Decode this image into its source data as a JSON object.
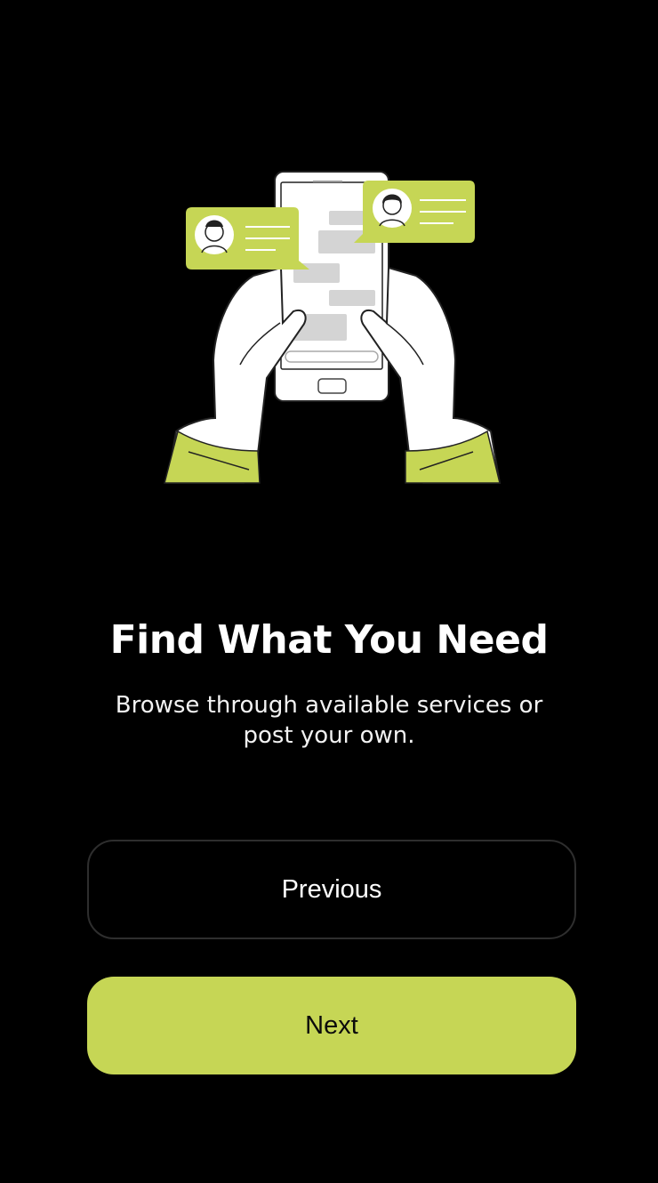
{
  "onboarding": {
    "illustration": "hands-holding-phone-chat-icon",
    "title": "Find What You Need",
    "subtitle": "Browse through available services or post your own."
  },
  "actions": {
    "previous_label": "Previous",
    "next_label": "Next"
  },
  "colors": {
    "background": "#000000",
    "accent": "#c6d655",
    "text": "#ffffff"
  }
}
